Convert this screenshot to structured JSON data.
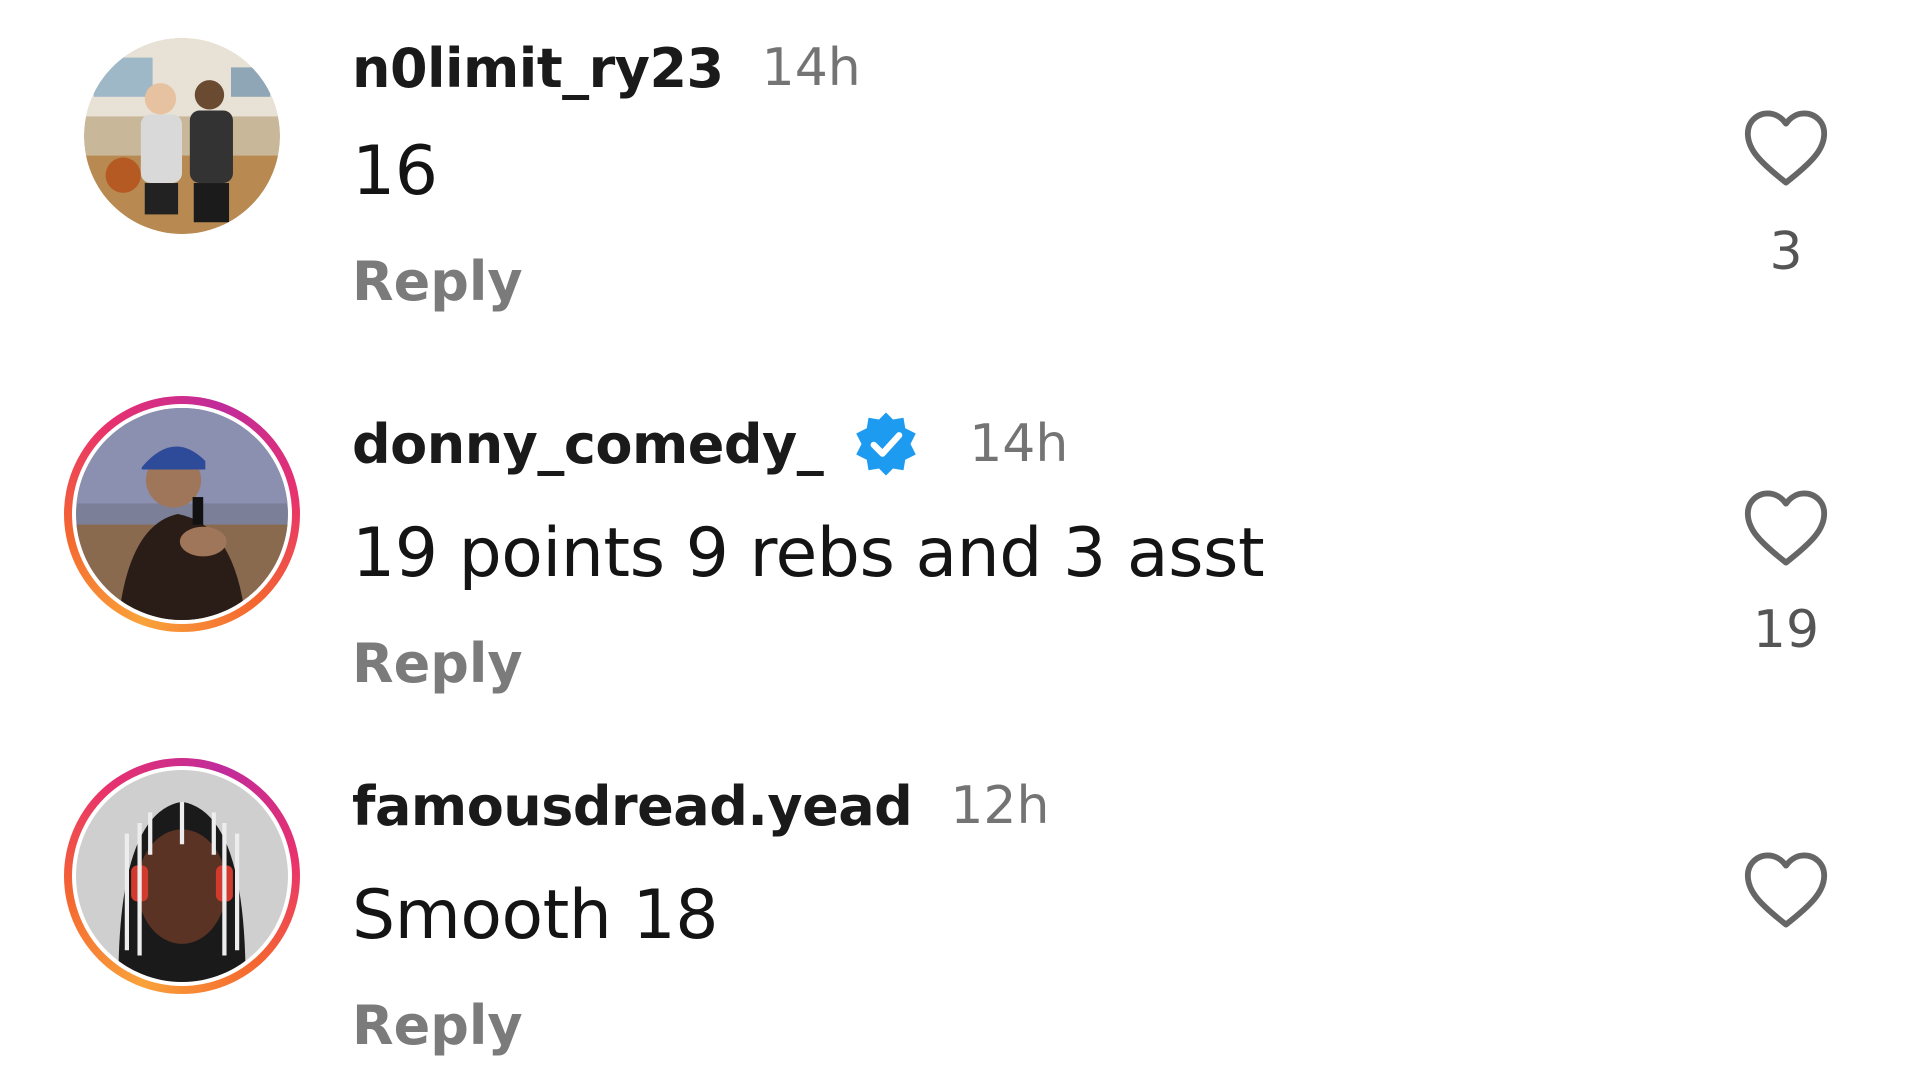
{
  "comments": [
    {
      "username": "n0limit_ry23",
      "time": "14h",
      "verified": false,
      "text": "16",
      "reply_label": "Reply",
      "likes": "3",
      "avatar": "avatar-photo-two-people-gym",
      "story_ring": false
    },
    {
      "username": "donny_comedy_",
      "time": "14h",
      "verified": true,
      "text": "19  points 9 rebs and 3 asst",
      "reply_label": "Reply",
      "likes": "19",
      "avatar": "avatar-photo-man-with-microphone",
      "story_ring": true
    },
    {
      "username": "famousdread.yead",
      "time": "12h",
      "verified": false,
      "text": "Smooth 18",
      "reply_label": "Reply",
      "likes": "",
      "avatar": "avatar-photo-man-with-headphones",
      "story_ring": true
    }
  ],
  "icons": {
    "like": "heart-outline-icon",
    "verified": "verified-badge-icon"
  },
  "colors": {
    "verified_blue": "#1d9bf0",
    "story_ring_start": "#f9a23a",
    "story_ring_end": "#c02b9b",
    "muted_text": "#747474"
  }
}
